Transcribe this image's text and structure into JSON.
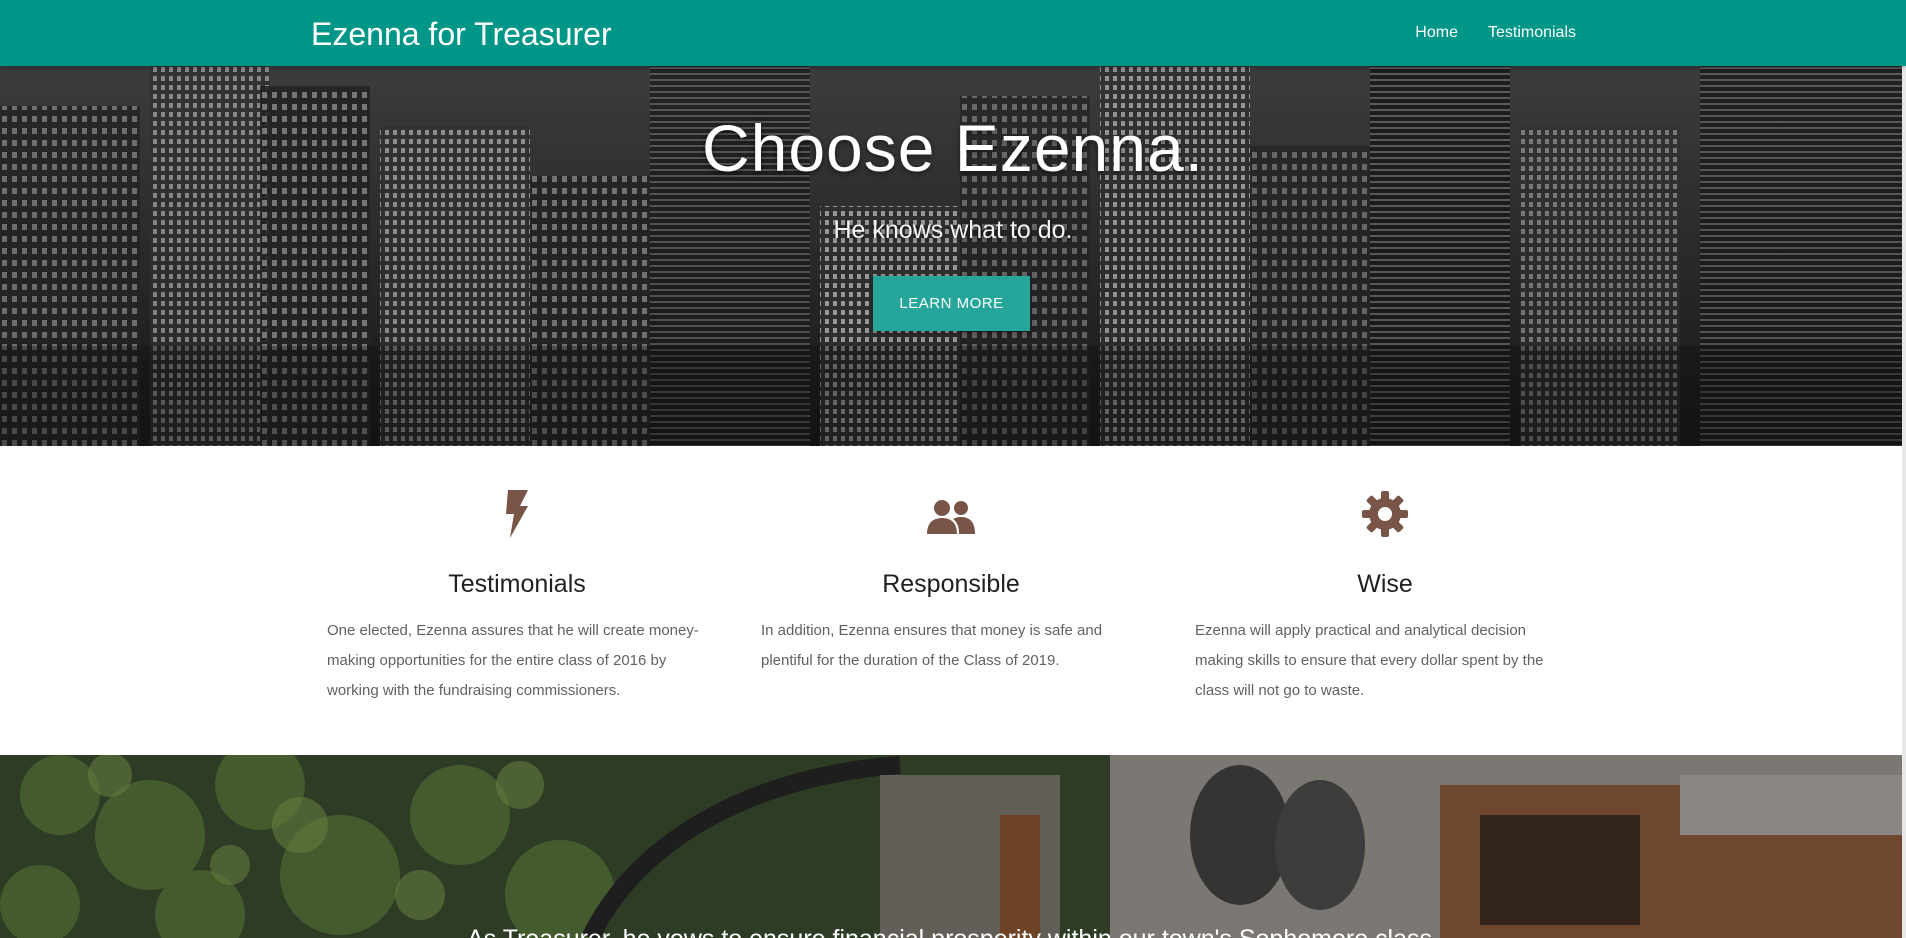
{
  "navbar": {
    "brand": "Ezenna for Treasurer",
    "links": [
      {
        "label": "Home"
      },
      {
        "label": "Testimonials"
      }
    ],
    "color": "#009688"
  },
  "hero": {
    "title": "Choose Ezenna.",
    "subtitle": "He knows what to do.",
    "button_label": "LEARN MORE",
    "button_color": "#26a69a"
  },
  "features": [
    {
      "icon": "bolt-icon",
      "title": "Testimonials",
      "text": "One elected, Ezenna assures that he will create money-making opportunities for the entire class of 2016 by working with the fundraising commissioners."
    },
    {
      "icon": "group-icon",
      "title": "Responsible",
      "text": "In addition, Ezenna ensures that money is safe and plentiful for the duration of the Class of 2019."
    },
    {
      "icon": "gear-icon",
      "title": "Wise",
      "text": "Ezenna will apply practical and analytical decision making skills to ensure that every dollar spent by the class will not go to waste."
    }
  ],
  "icon_color": "#795548",
  "bottom": {
    "caption": "As Treasurer, he vows to ensure financial prosperity within our town's Sophomore class."
  }
}
